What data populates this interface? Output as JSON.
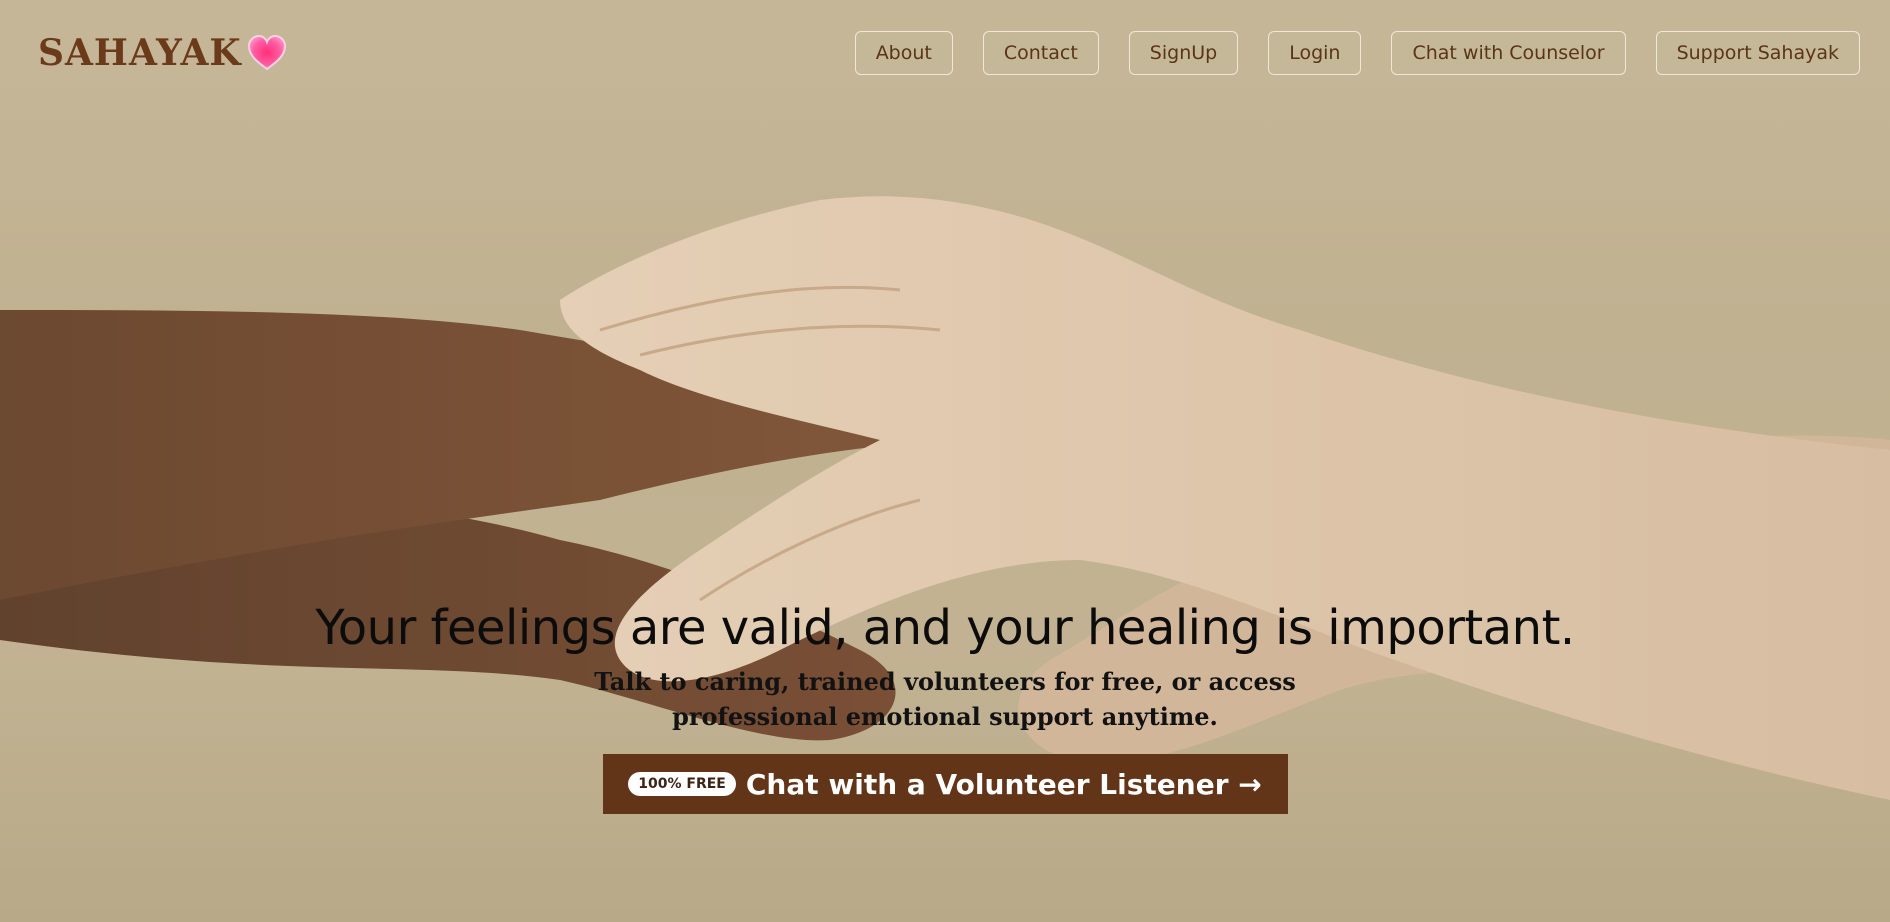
{
  "brand": {
    "name": "SAHAYAK",
    "icon": "heart-icon",
    "color": "#6b3a1a"
  },
  "nav": {
    "items": [
      {
        "label": "About"
      },
      {
        "label": "Contact"
      },
      {
        "label": "SignUp"
      },
      {
        "label": "Login"
      },
      {
        "label": "Chat with Counselor"
      },
      {
        "label": "Support Sahayak"
      }
    ]
  },
  "hero": {
    "image": "stacked-hands-photo",
    "headline": "Your feelings are valid, and your healing is important.",
    "subtitle": "Talk to caring, trained volunteers for free, or access professional emotional support anytime.",
    "cta": {
      "badge": "100% FREE",
      "label": "Chat with a Volunteer Listener →",
      "color": "#623418"
    }
  }
}
